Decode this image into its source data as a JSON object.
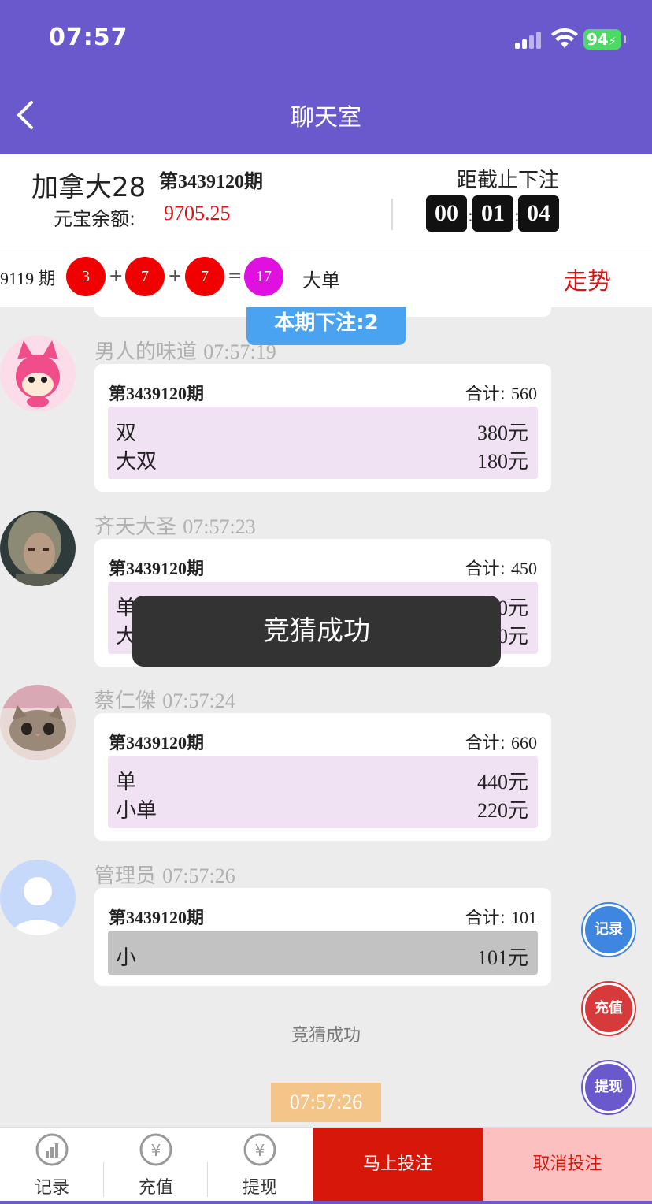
{
  "status_bar": {
    "time": "07:57",
    "battery": "94"
  },
  "nav": {
    "title": "聊天室"
  },
  "info": {
    "game_name": "加拿大28",
    "period": "第3439120期",
    "balance_label": "元宝余额:",
    "balance_value": "9705.25",
    "deadline_label": "距截止下注",
    "countdown": [
      "00",
      "01",
      "04"
    ]
  },
  "last_result": {
    "period": "9119 期",
    "numbers": [
      "3",
      "7",
      "7"
    ],
    "plus": "+",
    "equals": "=",
    "sum": "17",
    "type": "大单",
    "trend_label": "走势",
    "colors": {
      "ball": "#f00000",
      "sum": "#e010e0"
    }
  },
  "feed": {
    "bet_count_label": "本期下注:2",
    "messages": [
      {
        "user": "男人的味道",
        "time": "07:57:19",
        "period": "第3439120期",
        "total_label": "合计:",
        "total": "560",
        "items": [
          {
            "name": "双",
            "amount": "380元"
          },
          {
            "name": "大双",
            "amount": "180元"
          }
        ]
      },
      {
        "user": "齐天大圣",
        "time": "07:57:23",
        "period": "第3439120期",
        "total_label": "合计:",
        "total": "450",
        "items": [
          {
            "name": "单",
            "amount": "310元"
          },
          {
            "name": "大",
            "amount": "140元"
          }
        ]
      },
      {
        "user": "蔡仁傑",
        "time": "07:57:24",
        "period": "第3439120期",
        "total_label": "合计:",
        "total": "660",
        "items": [
          {
            "name": "单",
            "amount": "440元"
          },
          {
            "name": "小单",
            "amount": "220元"
          }
        ]
      },
      {
        "user": "管理员",
        "time": "07:57:26",
        "period": "第3439120期",
        "total_label": "合计:",
        "total": "101",
        "items": [
          {
            "name": "小",
            "amount": "101元"
          }
        ]
      }
    ],
    "success_text": "竞猜成功",
    "last_timestamp": "07:57:26"
  },
  "toast": "竞猜成功",
  "fabs": {
    "record": "记录",
    "recharge": "充值",
    "withdraw": "提现"
  },
  "bottom_bar": {
    "record": "记录",
    "recharge": "充值",
    "withdraw": "提现",
    "bet_now": "马上投注",
    "cancel_bet": "取消投注"
  },
  "colors": {
    "header": "#6a59cd",
    "accent_red": "#d8170b",
    "bet_count": "#4aa3f0"
  }
}
